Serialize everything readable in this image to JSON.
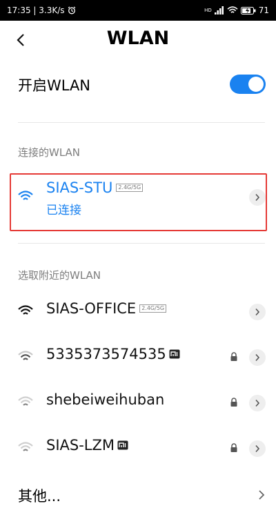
{
  "status_bar": {
    "time_speed": "17:35 | 3.3K/s",
    "network_tag": "HD",
    "battery_percent": "71"
  },
  "header": {
    "title": "WLAN"
  },
  "toggle": {
    "label": "开启WLAN",
    "on": true
  },
  "sections": {
    "connected_header": "连接的WLAN",
    "nearby_header": "选取附近的WLAN"
  },
  "connected_network": {
    "name": "SIAS-STU",
    "band": "2.4G/5G",
    "status": "已连接"
  },
  "nearby_networks": [
    {
      "name": "SIAS-OFFICE",
      "band": "2.4G/5G",
      "locked": false
    },
    {
      "name": "5335373574535",
      "band": "",
      "locked": true
    },
    {
      "name": "shebeiweihuban",
      "band": "",
      "locked": true
    },
    {
      "name": "SIAS-LZM",
      "band": "",
      "locked": true
    }
  ],
  "other": {
    "label": "其他..."
  },
  "colors": {
    "accent": "#1a82f0",
    "highlight_border": "#e53935"
  }
}
